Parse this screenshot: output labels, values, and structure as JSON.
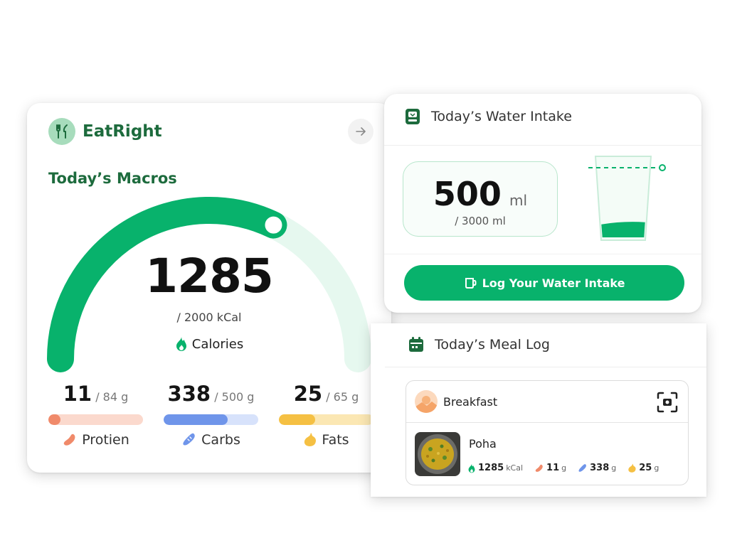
{
  "colors": {
    "brand_green": "#08b26c",
    "brand_dark": "#1d6b3d",
    "protein": "#f08a6a",
    "carbs": "#6f95ea",
    "fats": "#f5c043"
  },
  "macros_card": {
    "brand": "EatRight",
    "brand_icon": "fork-knife-icon",
    "title": "Today’s Macros",
    "arrow_icon": "arrow-right-icon",
    "calories": {
      "value": "1285",
      "goal": "/ 2000 kCal",
      "label": "Calories",
      "icon": "flame-icon",
      "progress_fraction": 0.6425
    },
    "macros": [
      {
        "value": "11",
        "goal": "/ 84 g",
        "label": "Protien",
        "icon": "sausage-icon",
        "progress_fraction": 0.13
      },
      {
        "value": "338",
        "goal": "/ 500 g",
        "label": "Carbs",
        "icon": "bread-icon",
        "progress_fraction": 0.68
      },
      {
        "value": "25",
        "goal": "/ 65 g",
        "label": "Fats",
        "icon": "drop-icon",
        "progress_fraction": 0.38
      }
    ]
  },
  "water_card": {
    "title": "Today’s Water Intake",
    "icon": "water-cooler-icon",
    "amount": "500",
    "unit": "ml",
    "goal": "/ 3000 ml",
    "progress_fraction": 0.167,
    "button_label": "Log Your Water Intake",
    "button_icon": "cup-icon"
  },
  "meal_card": {
    "title": "Today’s Meal Log",
    "icon": "calendar-icon",
    "meal_type": "Breakfast",
    "food": {
      "name": "Poha",
      "calories": "1285",
      "calories_unit": "kCal",
      "protein": "11",
      "protein_unit": "g",
      "carbs": "338",
      "carbs_unit": "g",
      "fats": "25",
      "fats_unit": "g"
    }
  }
}
